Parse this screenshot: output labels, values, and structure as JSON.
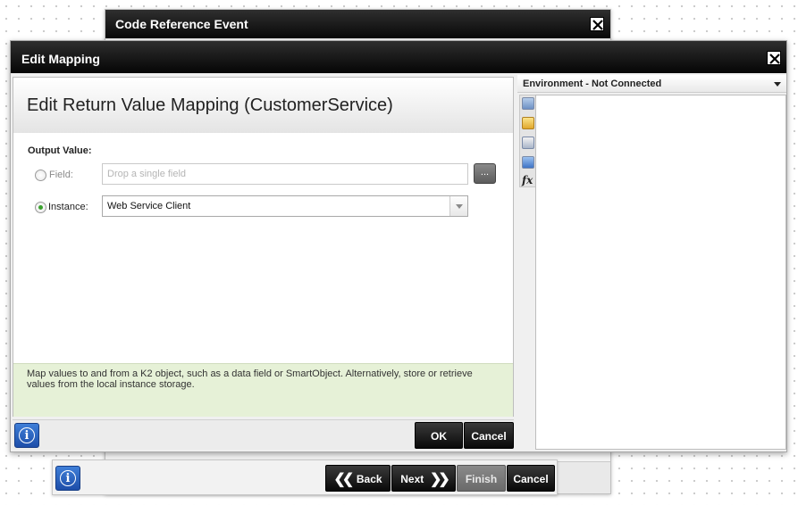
{
  "background_dialog": {
    "title": "Code Reference Event"
  },
  "dialog": {
    "title": "Edit Mapping",
    "form_title": "Edit Return Value Mapping (CustomerService)",
    "output_label": "Output Value:",
    "field": {
      "label": "Field:",
      "placeholder": "Drop a single field",
      "browse_label": "...",
      "selected": false
    },
    "instance": {
      "label": "Instance:",
      "value": "Web Service Client",
      "selected": true
    },
    "help_text": "Map values to and from a K2 object, such as a data field or SmartObject. Alternatively, store or retrieve values from the local instance storage.",
    "buttons": {
      "ok": "OK",
      "cancel": "Cancel"
    }
  },
  "environment": {
    "label": "Environment - Not Connected"
  },
  "toolbox": {
    "icons": [
      "image-icon",
      "folder-icon",
      "objects-icon",
      "list-icon",
      "function-icon"
    ],
    "fx_label": "fx"
  },
  "wizard": {
    "buttons": {
      "back": "Back",
      "next": "Next",
      "finish": "Finish",
      "cancel": "Cancel"
    }
  },
  "info_glyph": "i"
}
